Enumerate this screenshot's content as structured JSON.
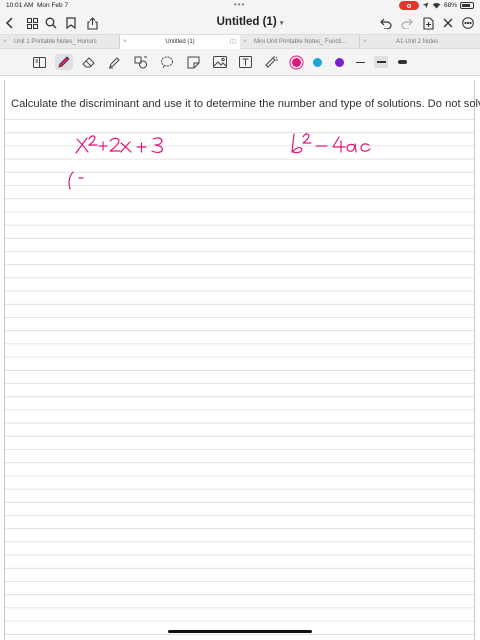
{
  "status_bar": {
    "time": "10:01 AM",
    "date": "Mon Feb 7",
    "battery": "68%"
  },
  "nav": {
    "title": "Untitled (1)"
  },
  "tabs": [
    {
      "label": "Unit 1 Printable Notes_ Honors",
      "active": false
    },
    {
      "label": "Untitled (1)",
      "active": true
    },
    {
      "label": "Mini Unit  Printable Notes_ Functi...",
      "active": false
    },
    {
      "label": "A1-Unit 2 Notes",
      "active": false
    }
  ],
  "toolbar": {
    "colors": [
      "#e0187e",
      "#1aa7d8",
      "#7a22c9"
    ],
    "selected_color": "#e0187e"
  },
  "document": {
    "question": "Calculate the discriminant and use it to determine the number and type of solutions. Do not solve.",
    "handwriting": [
      "x² + 2x + 3",
      "b² − 4ac",
      "(−"
    ]
  }
}
